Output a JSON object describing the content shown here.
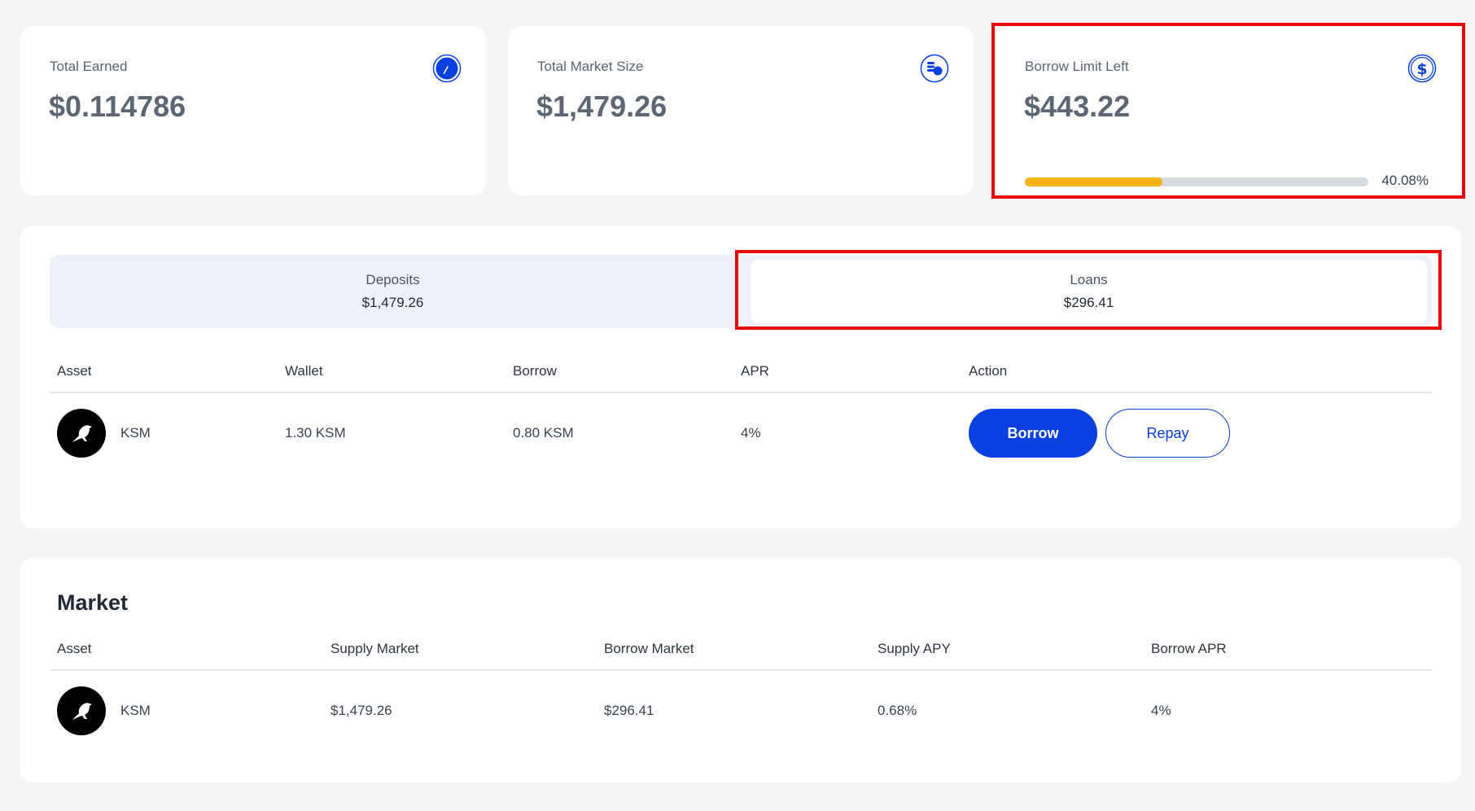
{
  "stats": {
    "earned": {
      "label": "Total Earned",
      "value": "$0.114786",
      "icon": "gauge-icon"
    },
    "market": {
      "label": "Total Market Size",
      "value": "$1,479.26",
      "icon": "coins-icon"
    },
    "borrow_limit": {
      "label": "Borrow Limit Left",
      "value": "$443.22",
      "icon": "dollar-icon",
      "progress_fraction": 0.4008,
      "progress_text": "40.08%"
    }
  },
  "tabs": {
    "deposits": {
      "label": "Deposits",
      "amount": "$1,479.26"
    },
    "loans": {
      "label": "Loans",
      "amount": "$296.41",
      "active": true
    }
  },
  "positions": {
    "headers": [
      "Asset",
      "Wallet",
      "Borrow",
      "APR",
      "Action"
    ],
    "rows": [
      {
        "asset": "KSM",
        "wallet": "1.30 KSM",
        "borrow": "0.80 KSM",
        "apr": "4%",
        "borrow_button": "Borrow",
        "repay_button": "Repay"
      }
    ]
  },
  "market": {
    "title": "Market",
    "headers": [
      "Asset",
      "Supply Market",
      "Borrow Market",
      "Supply APY",
      "Borrow APR"
    ],
    "rows": [
      {
        "asset": "KSM",
        "supply_market": "$1,479.26",
        "borrow_market": "$296.41",
        "supply_apy": "0.68%",
        "borrow_apr": "4%"
      }
    ]
  },
  "colors": {
    "accent": "#0a3fe0",
    "progress": "#f5b316",
    "highlight": "#e8070b",
    "background": "#f5f5f5"
  }
}
